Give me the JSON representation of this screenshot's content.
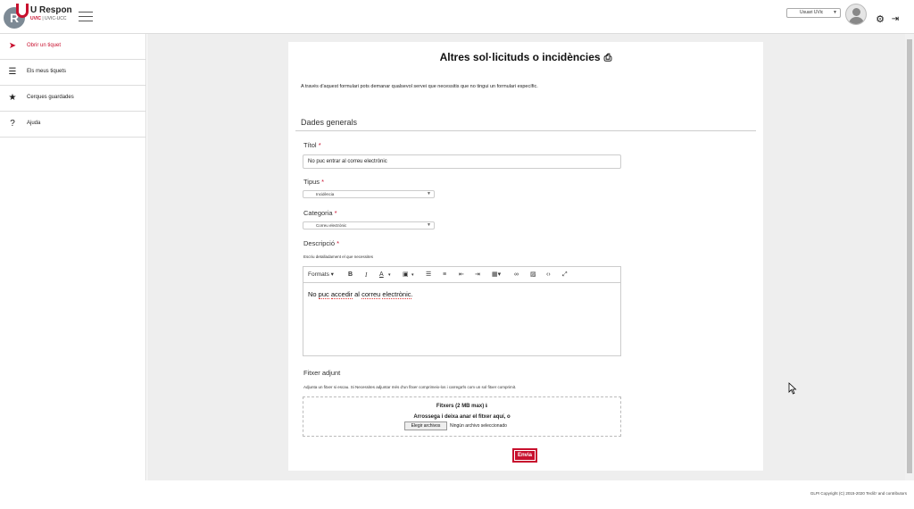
{
  "header": {
    "logo_letter": "R",
    "brand_title": "U Respon",
    "brand_org_red": "UVIC",
    "brand_org_rest": " | UVIC-UCC",
    "user_select": "Usuari UVic",
    "gear_glyph": "⚙",
    "logout_glyph": "⇥"
  },
  "sidebar": {
    "items": [
      {
        "label": "Obrir un tiquet",
        "icon": "paper-plane-icon",
        "glyph": "➤",
        "active": true
      },
      {
        "label": "Els meus tiquets",
        "icon": "list-icon",
        "glyph": "☰"
      },
      {
        "label": "Cerques guardades",
        "icon": "star-icon",
        "glyph": "★"
      },
      {
        "label": "Ajuda",
        "icon": "question-icon",
        "glyph": "?"
      }
    ]
  },
  "form": {
    "title": "Altres sol·licituds o incidències",
    "print_glyph": "⎙",
    "intro": "A través d'aquest formulari pots demanar qualsevol servei que necessitis que no tingui un formulari específic.",
    "section_title": "Dades generals",
    "fields": {
      "title_label": "Títol",
      "title_value": "No puc entrar al correu electrònic",
      "type_label": "Tipus",
      "type_value": "Incidència",
      "category_label": "Categoria",
      "category_value": "Correu electrònic",
      "description_label": "Descripció",
      "description_help": "Escriu detalladament el que necessites",
      "attachment_label": "Fitxer adjunt",
      "attachment_help": "Adjunta un fitxer si escau. Si Necessites adjuntar més d'un fitxer comprimeix-los i carrega'ls com un sol fitxer comprimit."
    },
    "required_mark": "*",
    "editor": {
      "formats_label": "Formats",
      "content_pre": "No ",
      "content_w1": "puc",
      "content_sp1": " ",
      "content_w2": "accedir",
      "content_mid": " al ",
      "content_w3": "correu",
      "content_sp2": " ",
      "content_w4": "electrònic",
      "content_end": "."
    },
    "dropzone": {
      "title": "Fitxers (2 MB max)",
      "info_glyph": "ℹ",
      "subtitle": "Arrossega i deixa anar el fitxer aquí, o",
      "choose_button": "Elegir archivos",
      "no_file": "Ningún archivo seleccionado"
    },
    "submit_label": "Envia"
  },
  "footer": {
    "copyright": "GLPI Copyright (C) 2015-2020 Teclib' and contributors"
  }
}
